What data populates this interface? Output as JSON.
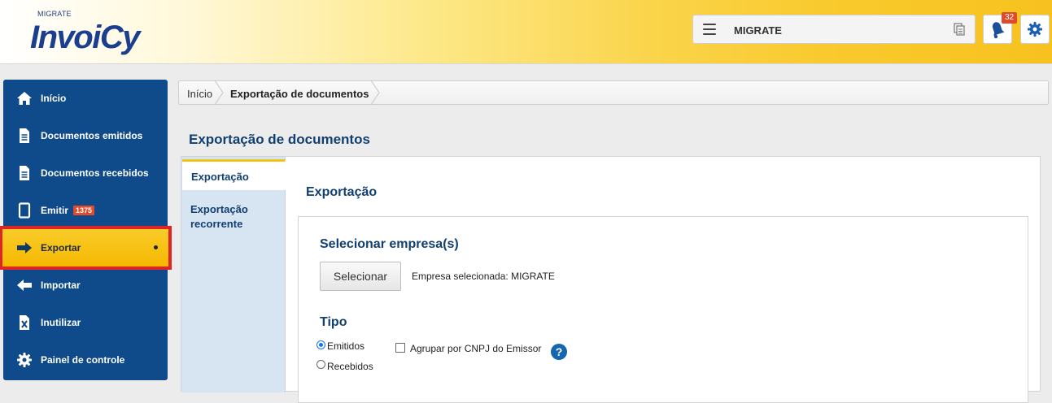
{
  "header": {
    "logo_top": "MIGRATE",
    "logo_main": "InvoiCy",
    "company": "MIGRATE",
    "notifications_count": "32"
  },
  "sidebar": {
    "items": [
      {
        "label": "Início",
        "icon": "home-icon"
      },
      {
        "label": "Documentos emitidos",
        "icon": "document-icon"
      },
      {
        "label": "Documentos recebidos",
        "icon": "document-icon"
      },
      {
        "label": "Emitir",
        "icon": "tablet-icon",
        "badge": "1375"
      },
      {
        "label": "Exportar",
        "icon": "arrow-right-icon",
        "active": true
      },
      {
        "label": "Importar",
        "icon": "arrow-left-icon"
      },
      {
        "label": "Inutilizar",
        "icon": "cancel-document-icon"
      },
      {
        "label": "Painel de controle",
        "icon": "gear-icon"
      }
    ]
  },
  "breadcrumb": {
    "home": "Início",
    "current": "Exportação de documentos"
  },
  "page": {
    "title": "Exportação de documentos",
    "tabs": [
      {
        "label": "Exportação",
        "active": true
      },
      {
        "label": "Exportação recorrente",
        "active": false
      }
    ],
    "section_title": "Exportação",
    "empresa": {
      "title": "Selecionar empresa(s)",
      "button": "Selecionar",
      "selected_text": "Empresa selecionada: MIGRATE"
    },
    "tipo": {
      "title": "Tipo",
      "options": [
        {
          "label": "Emitidos",
          "selected": true
        },
        {
          "label": "Recebidos",
          "selected": false
        }
      ],
      "group_checkbox": "Agrupar por CNPJ do Emissor",
      "group_checked": false,
      "help": "?"
    }
  },
  "colors": {
    "sidebar": "#0f4a8a",
    "active": "#f5b800",
    "title": "#123f72",
    "highlight": "#e02323"
  }
}
